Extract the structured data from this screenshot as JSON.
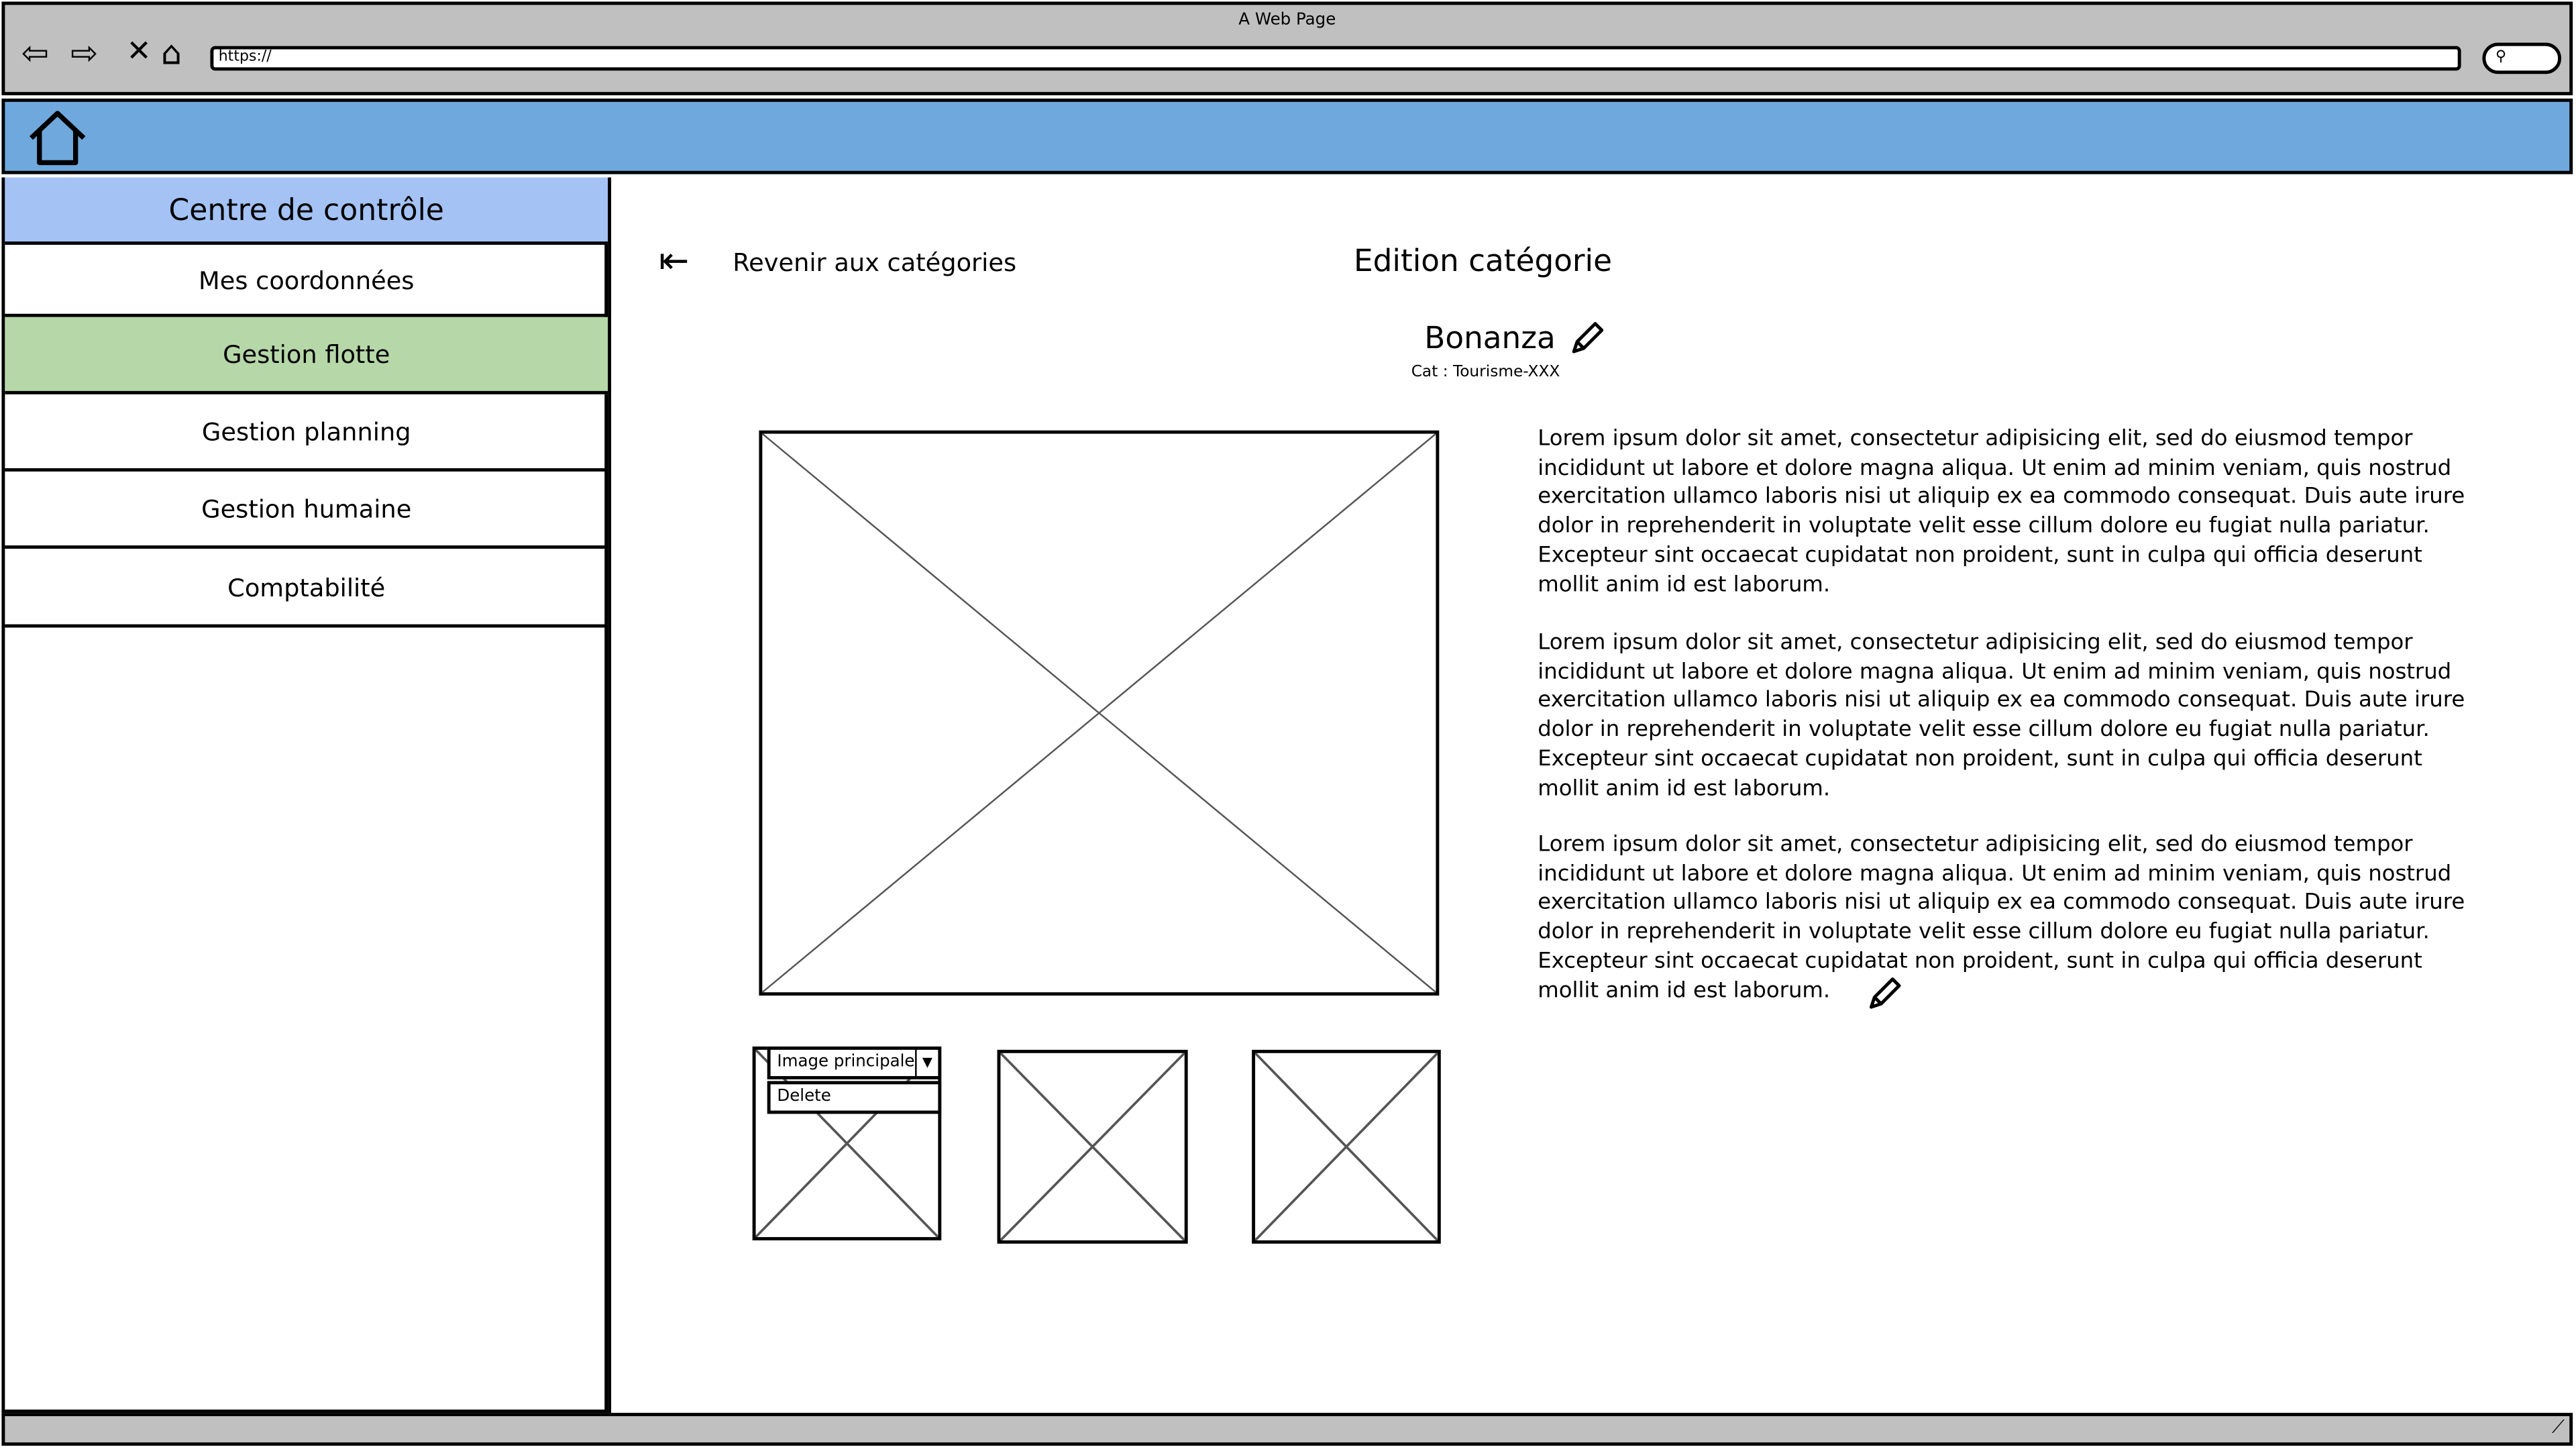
{
  "browser": {
    "title": "A Web Page",
    "url": "https://",
    "icons": [
      "back-arrow-icon",
      "forward-arrow-icon",
      "close-icon",
      "home-icon",
      "search-icon"
    ]
  },
  "sidebar": {
    "header": "Centre de contrôle",
    "items": [
      {
        "label": "Mes coordonnées"
      },
      {
        "label": "Gestion flotte",
        "active": true
      },
      {
        "label": "Gestion planning"
      },
      {
        "label": "Gestion humaine"
      },
      {
        "label": "Comptabilité"
      }
    ]
  },
  "colors": {
    "banner": "#6fa8dc",
    "sidebar_header": "#a4c2f4",
    "active_item": "#b6d7a8",
    "chrome": "#c0c0c0"
  },
  "main": {
    "back_label": "Revenir aux catégories",
    "title": "Edition catégorie",
    "name": "Bonanza",
    "category": "Cat : Tourisme-XXX",
    "paragraphs": [
      "Lorem ipsum dolor sit amet, consectetur adipisicing elit, sed do eiusmod tempor incididunt ut labore et dolore magna aliqua. Ut enim ad minim veniam, quis nostrud exercitation ullamco laboris nisi ut aliquip ex ea commodo consequat. Duis aute irure dolor in reprehenderit in voluptate velit esse cillum dolore eu fugiat nulla pariatur. Excepteur sint occaecat cupidatat non proident, sunt in culpa qui officia deserunt mollit anim id est laborum.",
      "Lorem ipsum dolor sit amet, consectetur adipisicing elit, sed do eiusmod tempor incididunt ut labore et dolore magna aliqua. Ut enim ad minim veniam, quis nostrud exercitation ullamco laboris nisi ut aliquip ex ea commodo consequat. Duis aute irure dolor in reprehenderit in voluptate velit esse cillum dolore eu fugiat nulla pariatur. Excepteur sint occaecat cupidatat non proident, sunt in culpa qui officia deserunt mollit anim id est laborum.",
      "Lorem ipsum dolor sit amet, consectetur adipisicing elit, sed do eiusmod tempor incididunt ut labore et dolore magna aliqua. Ut enim ad minim veniam, quis nostrud exercitation ullamco laboris nisi ut aliquip ex ea commodo consequat. Duis aute irure dolor in reprehenderit in voluptate velit esse cillum dolore eu fugiat nulla pariatur. Excepteur sint occaecat cupidatat non proident, sunt in culpa qui officia deserunt mollit anim id est laborum."
    ],
    "image_select": {
      "selected": "Image principale",
      "option": "Delete"
    }
  }
}
